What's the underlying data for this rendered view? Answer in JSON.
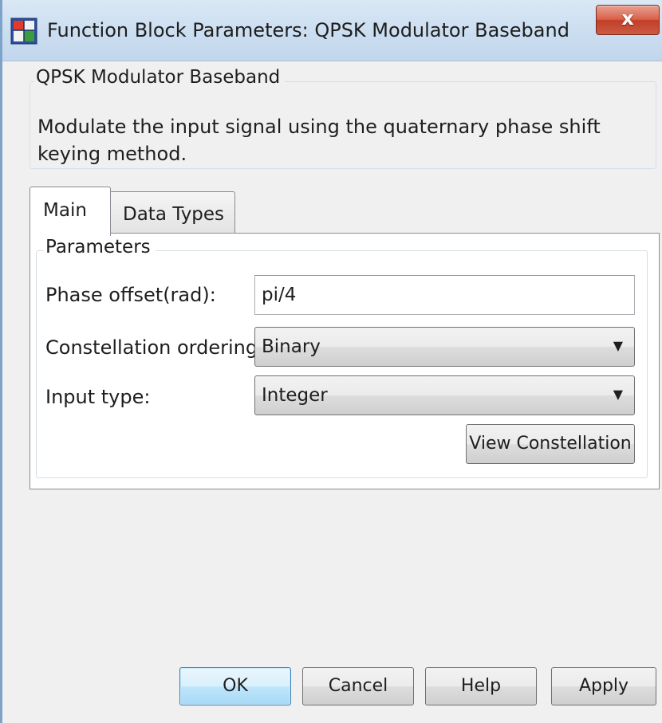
{
  "window": {
    "title": "Function Block Parameters: QPSK Modulator Baseband",
    "close_label": "x"
  },
  "description": {
    "group_title": "QPSK Modulator Baseband",
    "text": "Modulate the input signal using the quaternary phase shift keying method."
  },
  "tabs": [
    {
      "label": "Main",
      "selected": true
    },
    {
      "label": "Data Types",
      "selected": false
    }
  ],
  "parameters": {
    "group_title": "Parameters",
    "phase_offset": {
      "label": "Phase offset(rad):",
      "value": "pi/4"
    },
    "constellation_ordering": {
      "label": "Constellation ordering:",
      "value": "Binary"
    },
    "input_type": {
      "label": "Input type:",
      "value": "Integer"
    },
    "view_button_label": "View Constellation"
  },
  "buttons": {
    "ok": "OK",
    "cancel": "Cancel",
    "help": "Help",
    "apply": "Apply"
  },
  "icons": {
    "window_icon": "simulink-block-icon",
    "dropdown_arrow": "▼"
  },
  "colors": {
    "titlebar": "#cddff1",
    "close_button": "#c94b34",
    "default_button": "#bee6fd"
  }
}
